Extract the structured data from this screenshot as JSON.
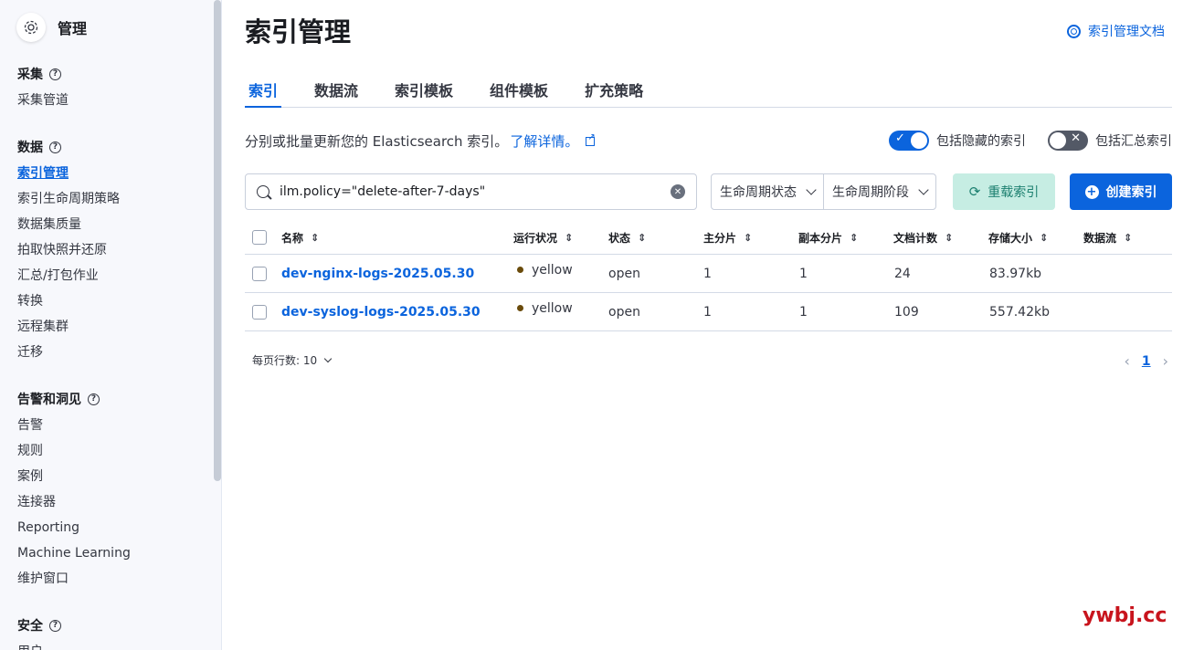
{
  "sidebar": {
    "title": "管理",
    "groups": [
      {
        "title": "采集",
        "items": [
          "采集管道"
        ]
      },
      {
        "title": "数据",
        "items": [
          "索引管理",
          "索引生命周期策略",
          "数据集质量",
          "拍取快照并还原",
          "汇总/打包作业",
          "转换",
          "远程集群",
          "迁移"
        ]
      },
      {
        "title": "告警和洞见",
        "items": [
          "告警",
          "规则",
          "案例",
          "连接器",
          "Reporting",
          "Machine Learning",
          "维护窗口"
        ]
      },
      {
        "title": "安全",
        "items": [
          "用户"
        ]
      }
    ],
    "active_item": "索引管理"
  },
  "header": {
    "title": "索引管理",
    "doc_link": "索引管理文档"
  },
  "tabs": [
    "索引",
    "数据流",
    "索引模板",
    "组件模板",
    "扩充策略"
  ],
  "description": {
    "text": "分别或批量更新您的 Elasticsearch 索引。",
    "link": "了解详情。"
  },
  "toggles": {
    "hidden": {
      "label": "包括隐藏的索引",
      "state": "on"
    },
    "rollup": {
      "label": "包括汇总索引",
      "state": "off"
    }
  },
  "search": {
    "value": "ilm.policy=\"delete-after-7-days\""
  },
  "filters": [
    "生命周期状态",
    "生命周期阶段"
  ],
  "buttons": {
    "reload": "重载索引",
    "create": "创建索引"
  },
  "table": {
    "headers": [
      "名称",
      "运行状况",
      "状态",
      "主分片",
      "副本分片",
      "文档计数",
      "存储大小",
      "数据流"
    ],
    "rows": [
      {
        "name": "dev-nginx-logs-2025.05.30",
        "health": "yellow",
        "status": "open",
        "primary": "1",
        "replica": "1",
        "docs": "24",
        "size": "83.97kb",
        "stream": ""
      },
      {
        "name": "dev-syslog-logs-2025.05.30",
        "health": "yellow",
        "status": "open",
        "primary": "1",
        "replica": "1",
        "docs": "109",
        "size": "557.42kb",
        "stream": ""
      }
    ]
  },
  "pagination": {
    "rows_per_page": "每页行数: 10",
    "current_page": "1"
  },
  "watermark": "ywbj.cc",
  "colors": {
    "accent": "#0b64dd",
    "health_yellow": "#6a4b0b",
    "reload_bg": "#c6ede3"
  }
}
